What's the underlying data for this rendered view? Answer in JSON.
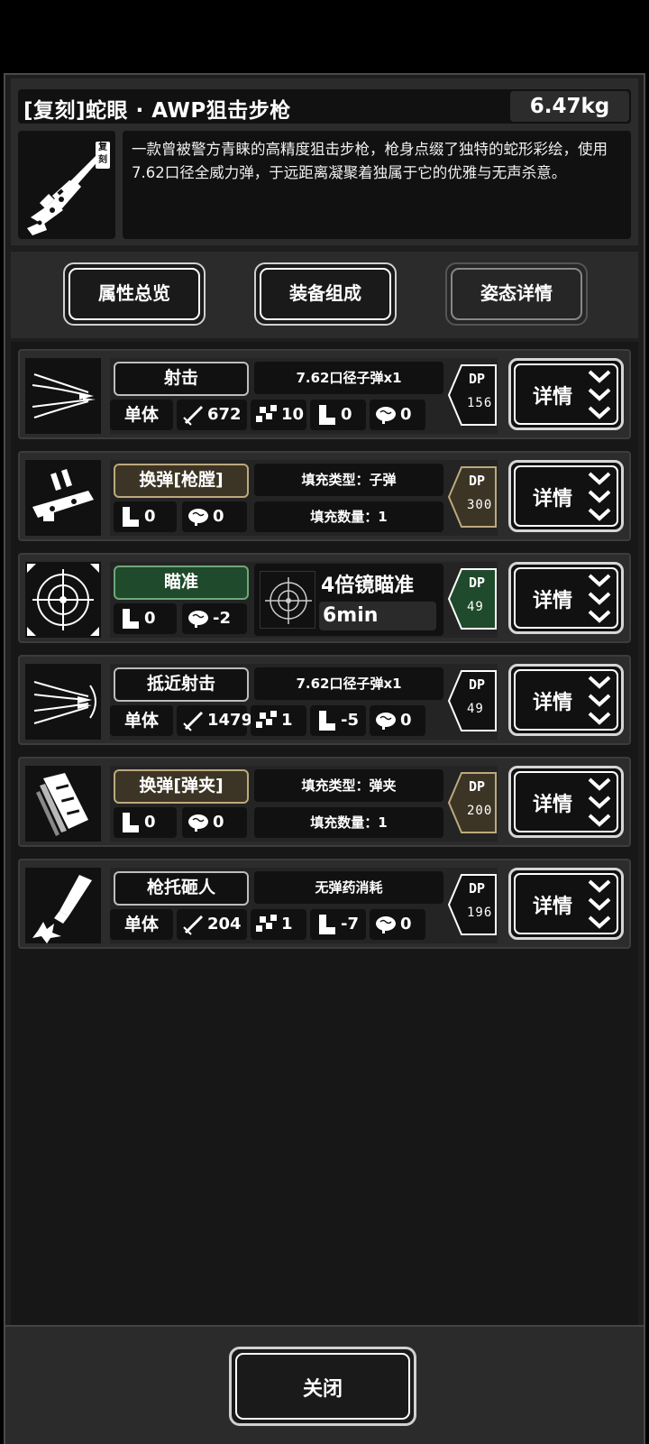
{
  "item": {
    "title": "[复刻]蛇眼 · AWP狙击步枪",
    "weight": "6.47kg",
    "tag": "复刻",
    "description": "一款曾被警方青睐的高精度狙击步枪，枪身点缀了独特的蛇形彩绘，使用7.62口径全威力弹，于远距离凝聚着独属于它的优雅与无声杀意。"
  },
  "tabs": [
    {
      "label": "属性总览"
    },
    {
      "label": "装备组成"
    },
    {
      "label": "姿态详情"
    }
  ],
  "actions": [
    {
      "name": "射击",
      "ammo": "7.62口径子弹x1",
      "target": "单体",
      "damage": "672",
      "hit": "10",
      "move": "0",
      "stamina": "0",
      "dp": "156"
    },
    {
      "name": "换弹[枪膛]",
      "fill_type": "填充类型：子弹",
      "fill_count": "填充数量：1",
      "move": "0",
      "stamina": "0",
      "dp": "300"
    },
    {
      "name": "瞄准",
      "scope_name": "4倍镜瞄准",
      "scope_time": "6min",
      "move": "0",
      "stamina": "-2",
      "dp": "49"
    },
    {
      "name": "抵近射击",
      "ammo": "7.62口径子弹x1",
      "target": "单体",
      "damage": "1479",
      "hit": "1",
      "move": "-5",
      "stamina": "0",
      "dp": "49"
    },
    {
      "name": "换弹[弹夹]",
      "fill_type": "填充类型：弹夹",
      "fill_count": "填充数量：1",
      "move": "0",
      "stamina": "0",
      "dp": "200"
    },
    {
      "name": "枪托砸人",
      "ammo": "无弹药消耗",
      "target": "单体",
      "damage": "204",
      "hit": "1",
      "move": "-7",
      "stamina": "0",
      "dp": "196"
    }
  ],
  "dp_label": "DP",
  "detail_label": "详情",
  "close_label": "关闭",
  "colors": {
    "dp_default": "#111111",
    "dp_reload": "#3c3526",
    "dp_aim": "#1f4a2b"
  }
}
